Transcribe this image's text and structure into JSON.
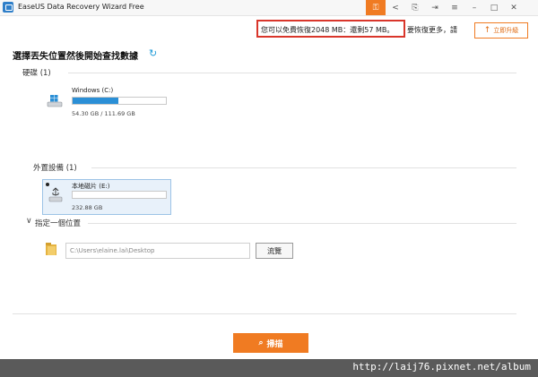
{
  "app": {
    "title": "EaseUS Data Recovery Wizard Free"
  },
  "quota": {
    "text": "您可以免費恢復2048 MB：還剩57 MB。",
    "more": "要恢復更多，請",
    "upgrade_label": "立即升級"
  },
  "main": {
    "title": "選擇丟失位置然後開始查找數據"
  },
  "hard_disks": {
    "title": "硬碟 (1)",
    "drives": [
      {
        "name": "Windows (C:)",
        "size": "54.30 GB / 111.69 GB",
        "used_fraction": 0.486
      }
    ]
  },
  "external": {
    "title": "外置設備 (1)",
    "drives": [
      {
        "name": "本地磁片 (E:)",
        "size": "232.88 GB",
        "used_fraction": 0.0
      }
    ]
  },
  "location": {
    "title": "指定一個位置",
    "path_value": "C:\\Users\\elaine.lai\\Desktop",
    "browse_label": "流覽"
  },
  "scan": {
    "label": "掃描"
  },
  "watermark": {
    "text": "http://laij76.pixnet.net/album"
  },
  "colors": {
    "accent": "#f07b22",
    "bar_fill": "#2b8fd6",
    "highlight_border": "#d9362b"
  }
}
